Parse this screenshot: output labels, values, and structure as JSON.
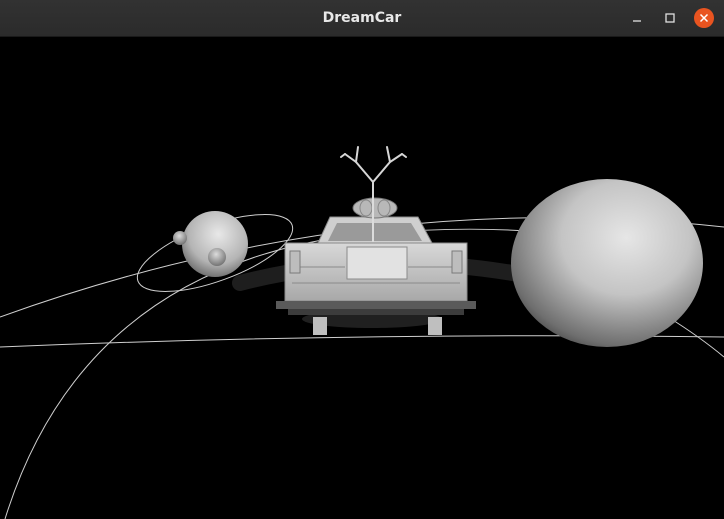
{
  "window": {
    "title": "DreamCar",
    "controls": {
      "minimize": "minimize-icon",
      "maximize": "maximize-icon",
      "close": "close-icon"
    },
    "close_color": "#e95420",
    "titlebar_color": "#2c2c2c"
  },
  "scene": {
    "background_color": "#000000",
    "objects": [
      "orbit-lines",
      "small-planet-with-ring",
      "moon",
      "car",
      "antlers",
      "large-sphere"
    ]
  }
}
